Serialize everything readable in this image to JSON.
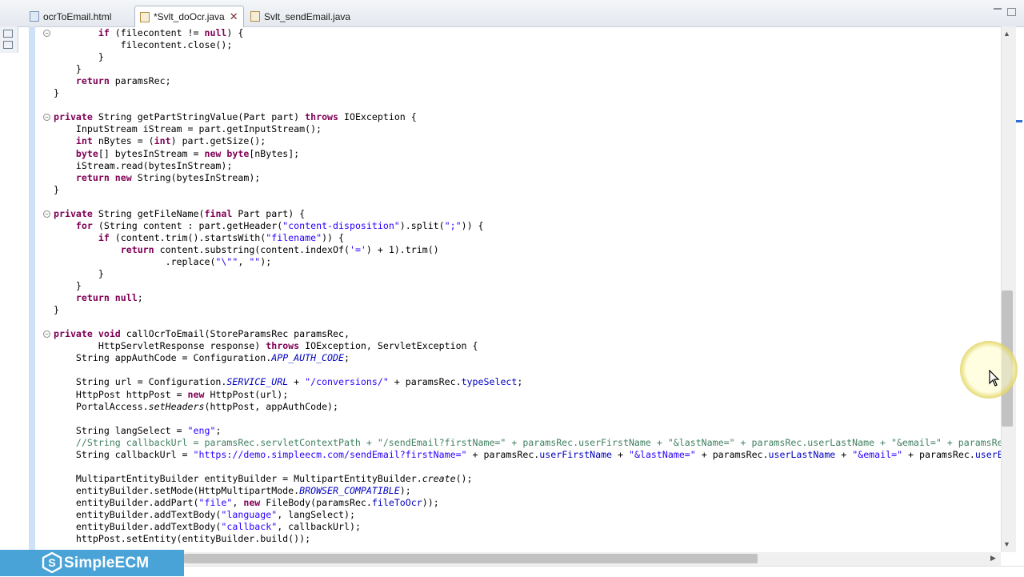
{
  "tabs": [
    {
      "label": "ocrToEmail.html",
      "type": "html",
      "active": false
    },
    {
      "label": "*Svlt_doOcr.java",
      "type": "java",
      "active": true
    },
    {
      "label": "Svlt_sendEmail.java",
      "type": "java",
      "active": false
    }
  ],
  "logo": {
    "text": "SimpleECM"
  },
  "code_lines": [
    [
      [
        "        ",
        ""
      ],
      [
        "if",
        "kw"
      ],
      [
        " (filecontent != ",
        ""
      ],
      [
        "null",
        "kw"
      ],
      [
        ") {",
        ""
      ]
    ],
    [
      [
        "            filecontent.close();",
        ""
      ]
    ],
    [
      [
        "        }",
        ""
      ]
    ],
    [
      [
        "    }",
        ""
      ]
    ],
    [
      [
        "    ",
        ""
      ],
      [
        "return",
        "kw"
      ],
      [
        " paramsRec;",
        ""
      ]
    ],
    [
      [
        "}",
        ""
      ]
    ],
    [
      [
        "",
        ""
      ]
    ],
    [
      [
        "",
        ""
      ],
      [
        "private",
        "kw"
      ],
      [
        " String getPartStringValue(Part part) ",
        ""
      ],
      [
        "throws",
        "kw"
      ],
      [
        " IOException {",
        ""
      ]
    ],
    [
      [
        "    InputStream iStream = part.getInputStream();",
        ""
      ]
    ],
    [
      [
        "    ",
        ""
      ],
      [
        "int",
        "kw"
      ],
      [
        " nBytes = (",
        ""
      ],
      [
        "int",
        "kw"
      ],
      [
        ") part.getSize();",
        ""
      ]
    ],
    [
      [
        "    ",
        ""
      ],
      [
        "byte",
        "kw"
      ],
      [
        "[] bytesInStream = ",
        ""
      ],
      [
        "new",
        "kw"
      ],
      [
        " ",
        ""
      ],
      [
        "byte",
        "kw"
      ],
      [
        "[nBytes];",
        ""
      ]
    ],
    [
      [
        "    iStream.read(bytesInStream);",
        ""
      ]
    ],
    [
      [
        "    ",
        ""
      ],
      [
        "return",
        "kw"
      ],
      [
        " ",
        ""
      ],
      [
        "new",
        "kw"
      ],
      [
        " String(bytesInStream);",
        ""
      ]
    ],
    [
      [
        "}",
        ""
      ]
    ],
    [
      [
        "",
        ""
      ]
    ],
    [
      [
        "",
        ""
      ],
      [
        "private",
        "kw"
      ],
      [
        " String getFileName(",
        ""
      ],
      [
        "final",
        "kw"
      ],
      [
        " Part part) {",
        ""
      ]
    ],
    [
      [
        "    ",
        ""
      ],
      [
        "for",
        "kw"
      ],
      [
        " (String content : part.getHeader(",
        ""
      ],
      [
        "\"content-disposition\"",
        "str"
      ],
      [
        ").split(",
        ""
      ],
      [
        "\";\"",
        "str"
      ],
      [
        ")) {",
        ""
      ]
    ],
    [
      [
        "        ",
        ""
      ],
      [
        "if",
        "kw"
      ],
      [
        " (content.trim().startsWith(",
        ""
      ],
      [
        "\"filename\"",
        "str"
      ],
      [
        ")) {",
        ""
      ]
    ],
    [
      [
        "            ",
        ""
      ],
      [
        "return",
        "kw"
      ],
      [
        " content.substring(content.indexOf(",
        ""
      ],
      [
        "'='",
        "str"
      ],
      [
        ") + 1).trim()",
        ""
      ]
    ],
    [
      [
        "                    .replace(",
        ""
      ],
      [
        "\"\\\"\"",
        "str"
      ],
      [
        ", ",
        ""
      ],
      [
        "\"\"",
        "str"
      ],
      [
        ");",
        ""
      ]
    ],
    [
      [
        "        }",
        ""
      ]
    ],
    [
      [
        "    }",
        ""
      ]
    ],
    [
      [
        "    ",
        ""
      ],
      [
        "return",
        "kw"
      ],
      [
        " ",
        ""
      ],
      [
        "null",
        "kw"
      ],
      [
        ";",
        ""
      ]
    ],
    [
      [
        "}",
        ""
      ]
    ],
    [
      [
        "",
        ""
      ]
    ],
    [
      [
        "",
        ""
      ],
      [
        "private",
        "kw"
      ],
      [
        " ",
        ""
      ],
      [
        "void",
        "kw"
      ],
      [
        " callOcrToEmail(StoreParamsRec paramsRec,",
        ""
      ]
    ],
    [
      [
        "        HttpServletResponse response) ",
        ""
      ],
      [
        "throws",
        "kw"
      ],
      [
        " IOException, ServletException {",
        ""
      ]
    ],
    [
      [
        "    String appAuthCode = Configuration.",
        ""
      ],
      [
        "APP_AUTH_CODE",
        "sfld"
      ],
      [
        ";",
        ""
      ]
    ],
    [
      [
        "",
        ""
      ]
    ],
    [
      [
        "    String url = Configuration.",
        ""
      ],
      [
        "SERVICE_URL",
        "sfld"
      ],
      [
        " + ",
        ""
      ],
      [
        "\"/conversions/\"",
        "str"
      ],
      [
        " + paramsRec.",
        ""
      ],
      [
        "typeSelect",
        "fld"
      ],
      [
        ";",
        ""
      ]
    ],
    [
      [
        "    HttpPost httpPost = ",
        ""
      ],
      [
        "new",
        "kw"
      ],
      [
        " HttpPost(url);",
        ""
      ]
    ],
    [
      [
        "    PortalAccess.",
        ""
      ],
      [
        "setHeaders",
        "sm"
      ],
      [
        "(httpPost, appAuthCode);",
        ""
      ]
    ],
    [
      [
        "",
        ""
      ]
    ],
    [
      [
        "    String langSelect = ",
        ""
      ],
      [
        "\"eng\"",
        "str"
      ],
      [
        ";",
        ""
      ]
    ],
    [
      [
        "    ",
        ""
      ],
      [
        "//String callbackUrl = paramsRec.servletContextPath + \"/sendEmail?firstName=\" + paramsRec.userFirstName + \"&lastName=\" + paramsRec.userLastName + \"&email=\" + paramsRec.userEmail;",
        "cmt"
      ]
    ],
    [
      [
        "    String callbackUrl = ",
        ""
      ],
      [
        "\"https://demo.simpleecm.com/sendEmail?firstName=\"",
        "str"
      ],
      [
        " + paramsRec.",
        ""
      ],
      [
        "userFirstName",
        "fld"
      ],
      [
        " + ",
        ""
      ],
      [
        "\"&lastName=\"",
        "str"
      ],
      [
        " + paramsRec.",
        ""
      ],
      [
        "userLastName",
        "fld"
      ],
      [
        " + ",
        ""
      ],
      [
        "\"&email=\"",
        "str"
      ],
      [
        " + paramsRec.",
        ""
      ],
      [
        "userEmail",
        "fld"
      ],
      [
        ";",
        ""
      ]
    ],
    [
      [
        "",
        ""
      ]
    ],
    [
      [
        "    MultipartEntityBuilder entityBuilder = MultipartEntityBuilder.",
        ""
      ],
      [
        "create",
        "sm"
      ],
      [
        "();",
        ""
      ]
    ],
    [
      [
        "    entityBuilder.setMode(HttpMultipartMode.",
        ""
      ],
      [
        "BROWSER_COMPATIBLE",
        "sfld"
      ],
      [
        ");",
        ""
      ]
    ],
    [
      [
        "    entityBuilder.addPart(",
        ""
      ],
      [
        "\"file\"",
        "str"
      ],
      [
        ", ",
        ""
      ],
      [
        "new",
        "kw"
      ],
      [
        " FileBody(paramsRec.",
        ""
      ],
      [
        "fileToOcr",
        "fld"
      ],
      [
        "));",
        ""
      ]
    ],
    [
      [
        "    entityBuilder.addTextBody(",
        ""
      ],
      [
        "\"language\"",
        "str"
      ],
      [
        ", langSelect);",
        ""
      ]
    ],
    [
      [
        "    entityBuilder.addTextBody(",
        ""
      ],
      [
        "\"callback\"",
        "str"
      ],
      [
        ", callbackUrl);",
        ""
      ]
    ],
    [
      [
        "    httpPost.setEntity(entityBuilder.build());",
        ""
      ]
    ]
  ],
  "fold_lines": [
    0,
    7,
    15,
    25
  ]
}
